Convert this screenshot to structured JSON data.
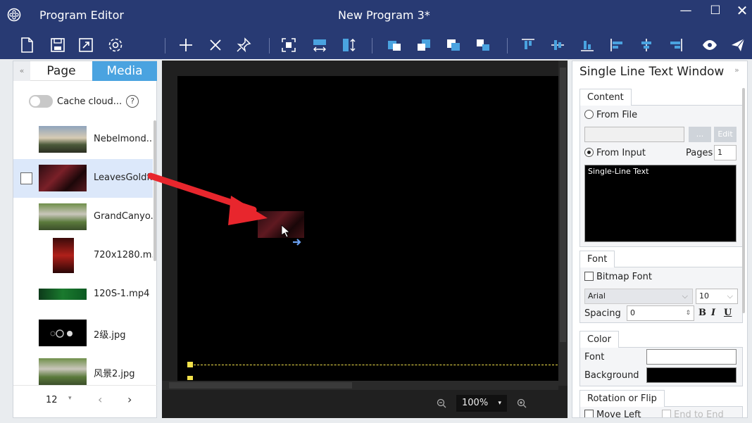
{
  "window": {
    "app_name": "Program Editor",
    "document_title": "New Program 3*",
    "colors": {
      "titlebar": "#283a73",
      "accent": "#4aa3e0",
      "drag_arrow": "#e8262d"
    }
  },
  "toolbar": {
    "icons": [
      "new-file-icon",
      "save-icon",
      "export-icon",
      "settings-icon",
      "add-icon",
      "delete-icon",
      "pin-icon",
      "fit-full-icon",
      "fit-width-icon",
      "fit-height-icon",
      "layer-up-icon",
      "layer-down-icon",
      "layer-top-icon",
      "layer-bottom-icon",
      "align-top-icon",
      "align-middle-icon",
      "align-bottom-icon",
      "align-left-icon",
      "align-center-icon",
      "align-right-icon",
      "preview-icon",
      "send-icon"
    ]
  },
  "left_panel": {
    "collapse": "«",
    "tabs": [
      "Page",
      "Media"
    ],
    "active_tab": "Media",
    "cache_label": "Cache cloud...",
    "help": "?",
    "media_items": [
      {
        "name": "Nebelmond..."
      },
      {
        "name": "LeavesGoldfi..."
      },
      {
        "name": "GrandCanyo..."
      },
      {
        "name": "720x1280.m..."
      },
      {
        "name": "120S-1.mp4"
      },
      {
        "name": "2级.jpg"
      },
      {
        "name": "风景2.jpg"
      }
    ],
    "pager": {
      "page_size": "12",
      "dropdown": "▾",
      "prev": "‹",
      "next": "›"
    }
  },
  "canvas": {
    "zoom": "100%",
    "zoom_dropdown": "▾"
  },
  "right_panel": {
    "title": "Single Line Text Window",
    "collapse": "»",
    "content": {
      "tab": "Content",
      "from_file": "From File",
      "browse": "...",
      "edit": "Edit",
      "from_input": "From Input",
      "pages_label": "Pages",
      "pages_value": "1",
      "text": "Single-Line Text"
    },
    "font": {
      "tab": "Font",
      "bitmap_font": "Bitmap Font",
      "family": "Arial",
      "size": "10",
      "spacing_label": "Spacing",
      "spacing_value": "0",
      "bold": "B",
      "italic": "I",
      "underline": "U"
    },
    "color": {
      "tab": "Color",
      "font_label": "Font",
      "font_color": "#ffffff",
      "background_label": "Background",
      "background_color": "#000000"
    },
    "rotation": {
      "tab": "Rotation or Flip",
      "move_left": "Move Left",
      "end_to_end": "End to End"
    }
  }
}
